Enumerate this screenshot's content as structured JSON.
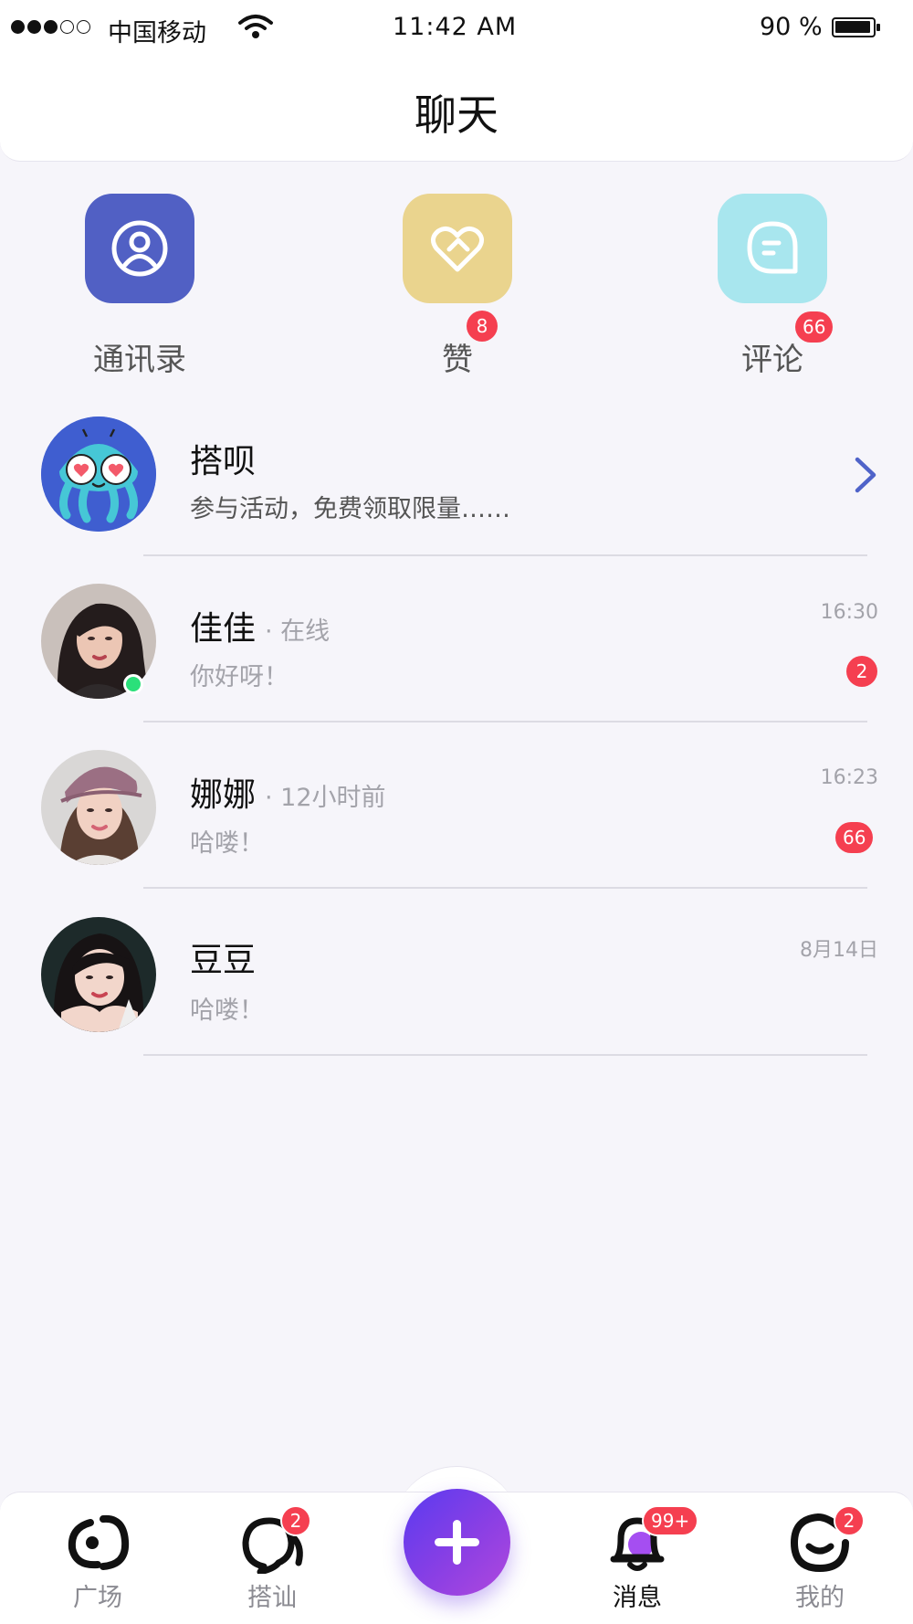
{
  "status_bar": {
    "carrier": "中国移动",
    "time": "11:42  AM",
    "battery": "90 %",
    "battery_level": 0.9,
    "signal_bars": 3
  },
  "header": {
    "title": "聊天"
  },
  "quick_actions": [
    {
      "label": "通讯录",
      "icon": "contacts-icon",
      "color": "#5160c4",
      "badge": ""
    },
    {
      "label": "赞",
      "icon": "heart-like-icon",
      "color": "#ead48e",
      "badge": "8"
    },
    {
      "label": "评论",
      "icon": "comment-icon",
      "color": "#a8e6ee",
      "badge": "66"
    }
  ],
  "chats": [
    {
      "name": "搭呗",
      "status": "",
      "message": "参与活动，免费领取限量……",
      "time": "",
      "badge": "",
      "avatar": "octopus-mascot",
      "has_arrow": true
    },
    {
      "name": "佳佳",
      "status": "· 在线",
      "message": "你好呀！",
      "time": "16:30",
      "badge": "2",
      "avatar": "user-photo",
      "online": true
    },
    {
      "name": "娜娜",
      "status": "· 12小时前",
      "message": "哈喽！",
      "time": "16:23",
      "badge": "66",
      "avatar": "user-photo"
    },
    {
      "name": "豆豆",
      "status": "",
      "message": "哈喽！",
      "time": "8月14日",
      "badge": "",
      "avatar": "user-photo"
    }
  ],
  "bottom_nav": [
    {
      "label": "广场",
      "icon": "square-icon",
      "badge": "",
      "active": false
    },
    {
      "label": "搭讪",
      "icon": "chat-bubbles-icon",
      "badge": "2",
      "active": false
    },
    {
      "label": "",
      "icon": "plus-icon",
      "badge": "",
      "active": false
    },
    {
      "label": "消息",
      "icon": "bell-icon",
      "badge": "99+",
      "active": true
    },
    {
      "label": "我的",
      "icon": "smile-icon",
      "badge": "2",
      "active": false
    }
  ],
  "colors": {
    "badge": "#f53f50",
    "accent": "#6a3cf0",
    "online": "#2be07a",
    "background": "#f6f5fa"
  }
}
